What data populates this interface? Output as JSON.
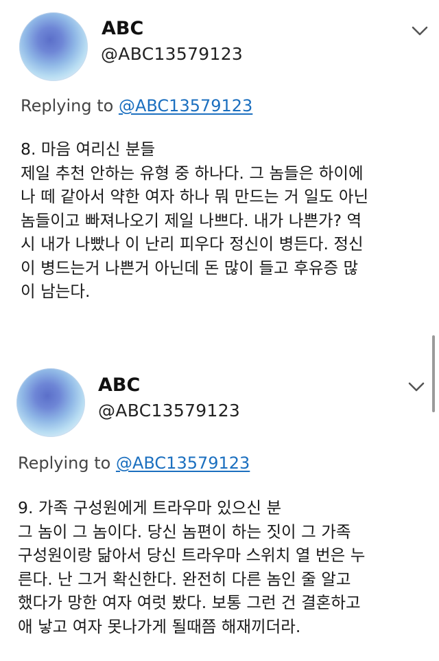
{
  "tweets": [
    {
      "name": "ABC",
      "handle": "@ABC13579123",
      "replying_prefix": "Replying to",
      "replying_to": "@ABC13579123",
      "lines": [
        "8. 마음 여리신 분들",
        "제일 추천 안하는 유형 중 하나다. 그 놈들은 하이에",
        "나 떼 같아서 약한 여자 하나 뭐 만드는 거 일도 아닌",
        "놈들이고 빠져나오기 제일 나쁘다. 내가 나쁜가? 역",
        "시 내가 나빴나 이 난리 피우다 정신이 병든다. 정신",
        "이 병드는거 나쁜거 아닌데 돈 많이 들고 후유증 많",
        "이 남는다."
      ]
    },
    {
      "name": "ABC",
      "handle": "@ABC13579123",
      "replying_prefix": "Replying to",
      "replying_to": "@ABC13579123",
      "lines": [
        "9. 가족 구성원에게 트라우마 있으신 분",
        "그 놈이 그 놈이다. 당신 놈편이 하는 짓이 그 가족",
        "구성원이랑 닮아서 당신 트라우마 스위치 열 번은 누",
        "른다. 난 그거 확신한다. 완전히 다른 놈인 줄 알고",
        "했다가 망한 여자 여럿 봤다. 보통 그런 건 결혼하고",
        "애 낳고 여자 못나가게 될때쯤 해재끼더라."
      ]
    }
  ]
}
